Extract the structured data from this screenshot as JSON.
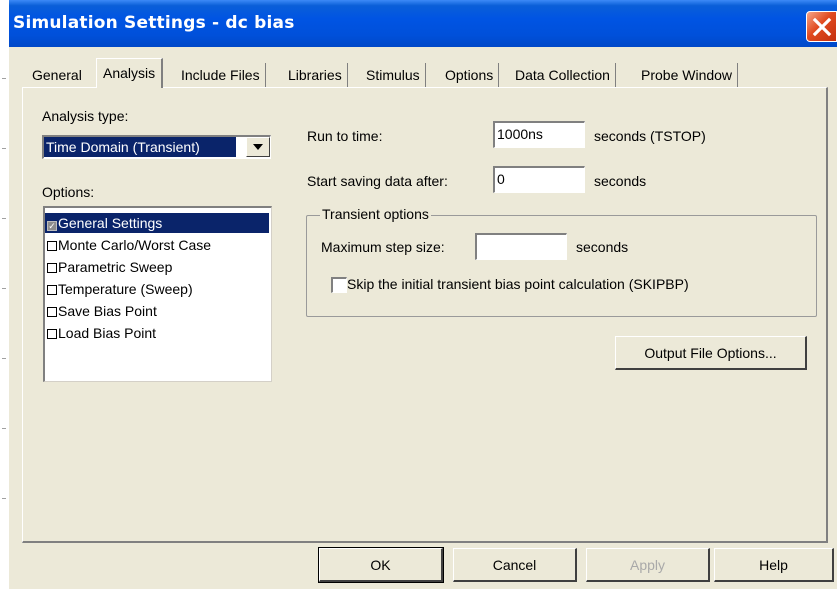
{
  "window": {
    "title": "Simulation Settings - dc bias"
  },
  "tabs": [
    {
      "label": "General"
    },
    {
      "label": "Analysis"
    },
    {
      "label": "Include Files"
    },
    {
      "label": "Libraries"
    },
    {
      "label": "Stimulus"
    },
    {
      "label": "Options"
    },
    {
      "label": "Data Collection"
    },
    {
      "label": "Probe Window"
    }
  ],
  "active_tab": "Analysis",
  "analysis": {
    "type_label": "Analysis type:",
    "type_value": "Time Domain (Transient)",
    "options_label": "Options:",
    "options": [
      {
        "label": "General Settings",
        "checked": true,
        "selected": true
      },
      {
        "label": "Monte Carlo/Worst Case",
        "checked": false,
        "selected": false
      },
      {
        "label": "Parametric Sweep",
        "checked": false,
        "selected": false
      },
      {
        "label": "Temperature (Sweep)",
        "checked": false,
        "selected": false
      },
      {
        "label": "Save Bias Point",
        "checked": false,
        "selected": false
      },
      {
        "label": "Load Bias Point",
        "checked": false,
        "selected": false
      }
    ]
  },
  "settings": {
    "run_to_time_label": "Run to time:",
    "run_to_time_value": "1000ns",
    "run_to_time_unit": "seconds  (TSTOP)",
    "start_saving_label": "Start saving data after:",
    "start_saving_value": "0",
    "start_saving_unit": "seconds",
    "transient_group_label": "Transient options",
    "max_step_label": "Maximum step size:",
    "max_step_value": "",
    "max_step_unit": "seconds",
    "skip_bias_label": "Skip the initial transient bias point calculation  (SKIPBP)",
    "skip_bias_checked": false,
    "output_file_button": "Output File Options..."
  },
  "footer": {
    "ok": "OK",
    "cancel": "Cancel",
    "apply": "Apply",
    "help": "Help"
  },
  "colors": {
    "titlebar": "#0054e3",
    "selection": "#0a246a",
    "dialog_face": "#ece9d8",
    "close_button": "#e04a1f"
  },
  "icons": {
    "close": "close-x-icon",
    "dropdown": "chevron-down-icon"
  }
}
